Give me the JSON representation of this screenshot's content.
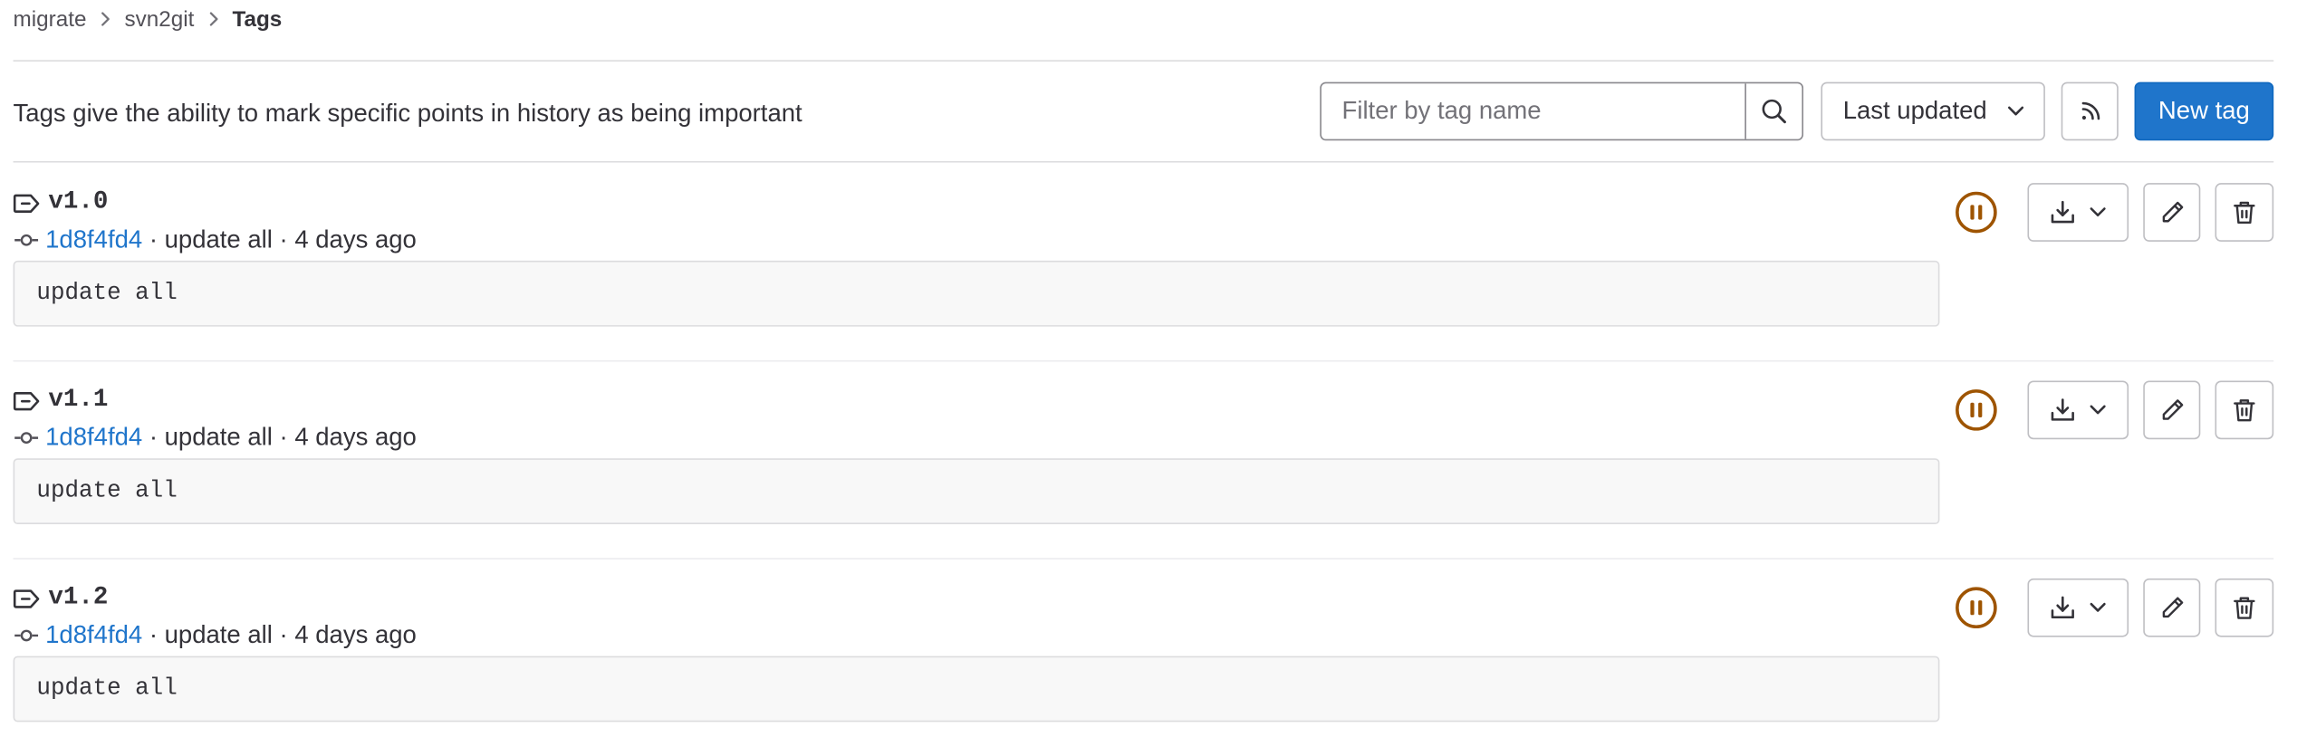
{
  "breadcrumb": {
    "items": [
      "migrate",
      "svn2git"
    ],
    "current": "Tags"
  },
  "header": {
    "description": "Tags give the ability to mark specific points in history as being important",
    "search": {
      "placeholder": "Filter by tag name",
      "value": ""
    },
    "sort": {
      "selected": "Last updated"
    },
    "rss_icon": "rss-icon",
    "new_tag_label": "New tag"
  },
  "colors": {
    "primary": "#1f75cb",
    "pipeline_status": "#9e5400",
    "text": "#333238",
    "border": "#dcdcde"
  },
  "tags": [
    {
      "name": "v1.0",
      "sha": "1d8f4fd4",
      "commit_title": "update all",
      "time": "4 days ago",
      "message": "update all",
      "pipeline_status_icon": "pause-icon"
    },
    {
      "name": "v1.1",
      "sha": "1d8f4fd4",
      "commit_title": "update all",
      "time": "4 days ago",
      "message": "update all",
      "pipeline_status_icon": "pause-icon"
    },
    {
      "name": "v1.2",
      "sha": "1d8f4fd4",
      "commit_title": "update all",
      "time": "4 days ago",
      "message": "update all",
      "pipeline_status_icon": "pause-icon"
    }
  ]
}
